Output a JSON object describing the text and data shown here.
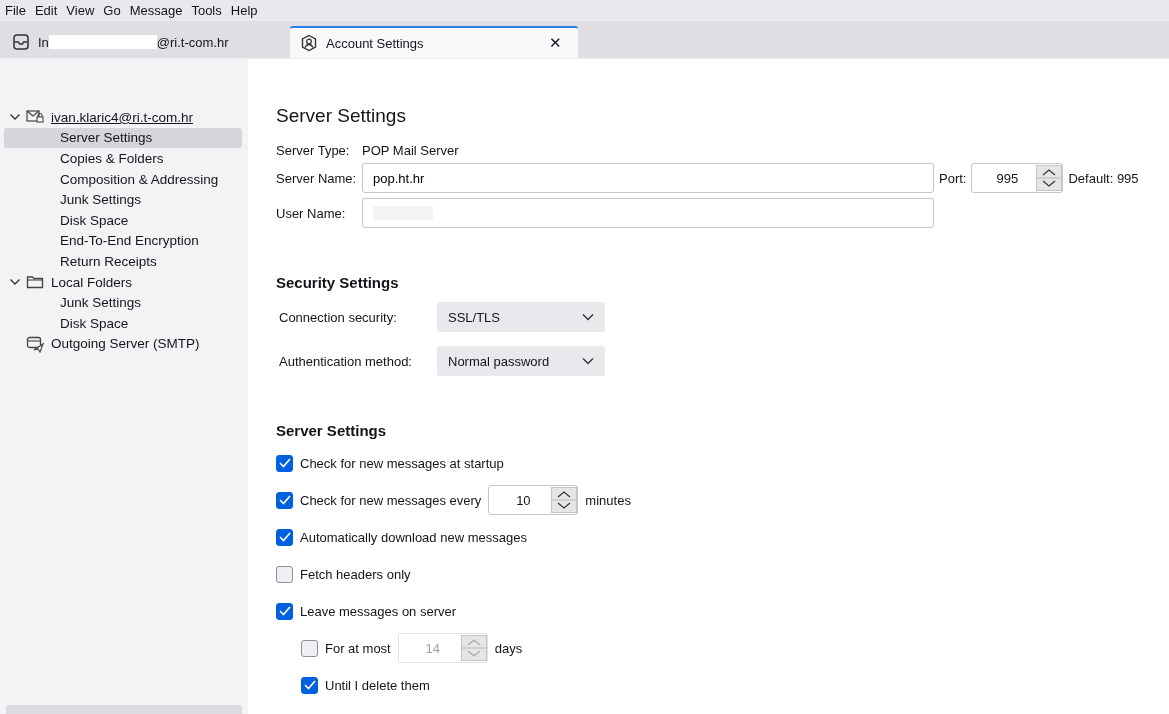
{
  "menu_bar": [
    "File",
    "Edit",
    "View",
    "Go",
    "Message",
    "Tools",
    "Help"
  ],
  "tabs": [
    {
      "label_start": "In",
      "label_end": "@ri.t-com.hr",
      "redacted": true,
      "selected": false,
      "closable": false
    },
    {
      "label_start": "Account Settings",
      "selected": true,
      "closable": true,
      "close_glyph": "✕"
    }
  ],
  "sidebar": {
    "items": [
      {
        "label": "ivan.klaric4@ri.t-com.hr",
        "kind": "mail-account",
        "expanded": true,
        "selected": false,
        "children": [
          {
            "label": "Server Settings",
            "selected": true
          },
          {
            "label": "Copies & Folders",
            "selected": false
          },
          {
            "label": "Composition & Addressing",
            "selected": false
          },
          {
            "label": "Junk Settings",
            "selected": false
          },
          {
            "label": "Disk Space",
            "selected": false
          },
          {
            "label": "End-To-End Encryption",
            "selected": false
          },
          {
            "label": "Return Receipts",
            "selected": false
          }
        ]
      },
      {
        "label": "Local Folders",
        "kind": "folder",
        "expanded": true,
        "selected": false,
        "children": [
          {
            "label": "Junk Settings",
            "selected": false
          },
          {
            "label": "Disk Space",
            "selected": false
          }
        ]
      },
      {
        "label": "Outgoing Server (SMTP)",
        "kind": "smtp",
        "selected": false
      }
    ]
  },
  "page": {
    "title": "Server Settings",
    "server_type_label": "Server Type:",
    "server_type": "POP Mail Server",
    "server_name_label": "Server Name:",
    "server_name": "pop.ht.hr",
    "port_label": "Port:",
    "port": "995",
    "default_port": "Default: 995",
    "user_name_label": "User Name:",
    "user_name_redacted": true,
    "security_heading": "Security Settings",
    "selects": [
      {
        "label": "Connection security:",
        "value": "SSL/TLS"
      },
      {
        "label": "Authentication method:",
        "value": "Normal password"
      }
    ],
    "server_heading": "Server Settings",
    "options": [
      {
        "kind": "checkbox",
        "label": "Check for new messages at startup",
        "checked": true
      },
      {
        "kind": "number",
        "label": "Check for new messages every",
        "checked": true,
        "value": "10",
        "unit": "minutes",
        "disabled": false
      },
      {
        "kind": "checkbox",
        "label": "Automatically download new messages",
        "checked": true
      },
      {
        "kind": "checkbox",
        "label": "Fetch headers only",
        "checked": false
      },
      {
        "kind": "checkbox",
        "label": "Leave messages on server",
        "checked": true,
        "children": [
          {
            "kind": "number",
            "label": "For at most",
            "checked": false,
            "value": "14",
            "unit": "days",
            "disabled": true
          },
          {
            "kind": "checkbox",
            "label": "Until I delete them",
            "checked": true
          }
        ]
      }
    ]
  }
}
